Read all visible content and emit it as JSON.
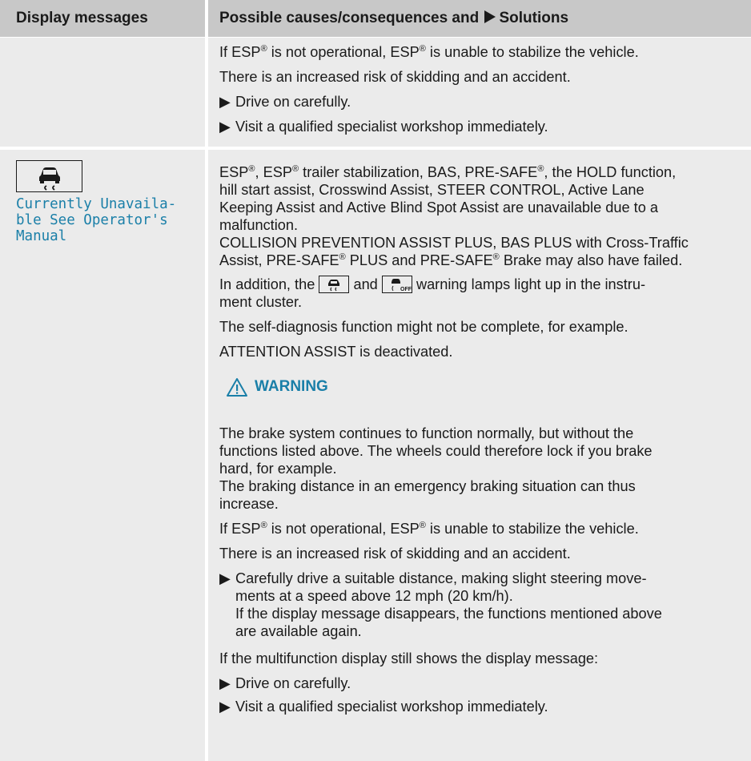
{
  "header": {
    "col1": "Display messages",
    "col2_pre": "Possible causes/consequences and",
    "col2_post": "Solutions"
  },
  "rowA": {
    "p1a": "If ESP",
    "p1b": " is not operational, ESP",
    "p1c": " is unable to stabilize the vehicle.",
    "p2": "There is an increased risk of skidding and an accident.",
    "b1": "Drive on carefully.",
    "b2": "Visit a qualified specialist workshop immediately."
  },
  "rowB": {
    "icon_name": "esp-skid-icon",
    "message_lines": [
      "Currently Unavaila-",
      "ble See Operator's",
      "Manual"
    ],
    "l1a": "ESP",
    "l1b": ", ESP",
    "l1c": " trailer stabilization, BAS, PRE-SAFE",
    "l1d": ", the HOLD function,",
    "l2": "hill start assist, Crosswind Assist, STEER CONTROL, Active Lane",
    "l3": "Keeping Assist and Active Blind Spot Assist are unavailable due to a",
    "l4": "malfunction.",
    "l5": "COLLISION PREVENTION ASSIST PLUS, BAS PLUS with Cross-Traffic",
    "l6a": "Assist, PRE-SAFE",
    "l6b": " PLUS and PRE-SAFE",
    "l6c": " Brake may also have failed.",
    "l7a": "In addition, the",
    "l7b": "and",
    "l7c": "warning lamps light up in the instru-",
    "l8": "ment cluster.",
    "l9": "The self-diagnosis function might not be complete, for example.",
    "l10": "ATTENTION ASSIST is deactivated.",
    "warning_title": "WARNING",
    "w1": "The brake system continues to function normally, but without the",
    "w2": "functions listed above. The wheels could therefore lock if you brake",
    "w3": "hard, for example.",
    "w4": "The braking distance in an emergency braking situation can thus",
    "w5": "increase.",
    "w6a": "If ESP",
    "w6b": " is not operational, ESP",
    "w6c": " is unable to stabilize the vehicle.",
    "w7": "There is an increased risk of skidding and an accident.",
    "s1": "Carefully drive a suitable distance, making slight steering move-",
    "s2": "ments at a speed above 12 mph (20 km/h).",
    "s3": "If the display message disappears, the functions mentioned above",
    "s4": "are available again.",
    "m1": "If the multifunction display still shows the display message:",
    "b1": "Drive on carefully.",
    "b2": "Visit a qualified specialist workshop immediately."
  },
  "symbols": {
    "reg": "®",
    "arrow": "▶"
  },
  "colors": {
    "header_bg": "#c8c8c8",
    "row_bg": "#ebebeb",
    "accent": "#1a7fa8"
  }
}
